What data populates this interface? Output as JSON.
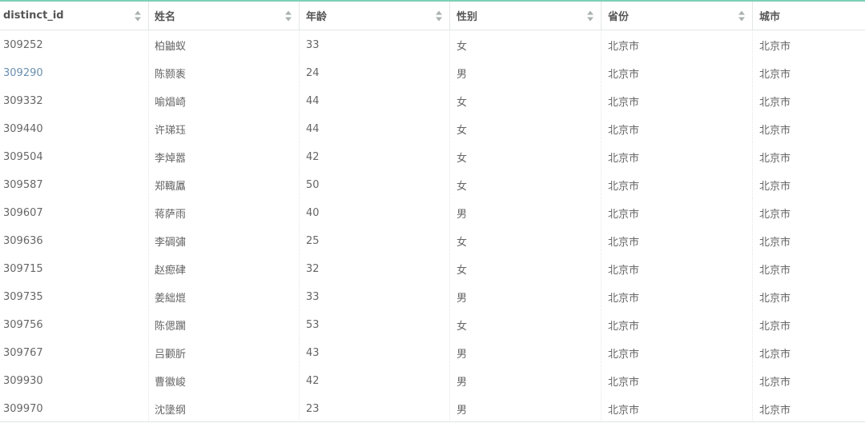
{
  "table": {
    "columns": [
      "distinct_id",
      "姓名",
      "年龄",
      "性别",
      "省份",
      "城市"
    ],
    "rows": [
      [
        "309252",
        "柏鼬蚁",
        "33",
        "女",
        "北京市",
        "北京市"
      ],
      [
        "309290",
        "陈颢袠",
        "24",
        "男",
        "北京市",
        "北京市"
      ],
      [
        "309332",
        "喻焻崎",
        "44",
        "女",
        "北京市",
        "北京市"
      ],
      [
        "309440",
        "许珶珏",
        "44",
        "女",
        "北京市",
        "北京市"
      ],
      [
        "309504",
        "李焯嚣",
        "42",
        "女",
        "北京市",
        "北京市"
      ],
      [
        "309587",
        "郑輙屭",
        "50",
        "女",
        "北京市",
        "北京市"
      ],
      [
        "309607",
        "蒋萨雨",
        "40",
        "男",
        "北京市",
        "北京市"
      ],
      [
        "309636",
        "李碉彇",
        "25",
        "女",
        "北京市",
        "北京市"
      ],
      [
        "309715",
        "赵瘛硉",
        "32",
        "女",
        "北京市",
        "北京市"
      ],
      [
        "309735",
        "姜絀熴",
        "33",
        "男",
        "北京市",
        "北京市"
      ],
      [
        "309756",
        "陈偲躙",
        "53",
        "女",
        "北京市",
        "北京市"
      ],
      [
        "309767",
        "吕颧肵",
        "43",
        "男",
        "北京市",
        "北京市"
      ],
      [
        "309930",
        "曹徽峻",
        "42",
        "男",
        "北京市",
        "北京市"
      ],
      [
        "309970",
        "沈墬纲",
        "23",
        "男",
        "北京市",
        "北京市"
      ]
    ],
    "highlighted_row": 1,
    "colors": {
      "accent_border": "#7ccfb6",
      "link_text": "#6a8fb0",
      "body_text": "#666666"
    },
    "icons": {
      "sort": "sort-both-icon"
    }
  }
}
